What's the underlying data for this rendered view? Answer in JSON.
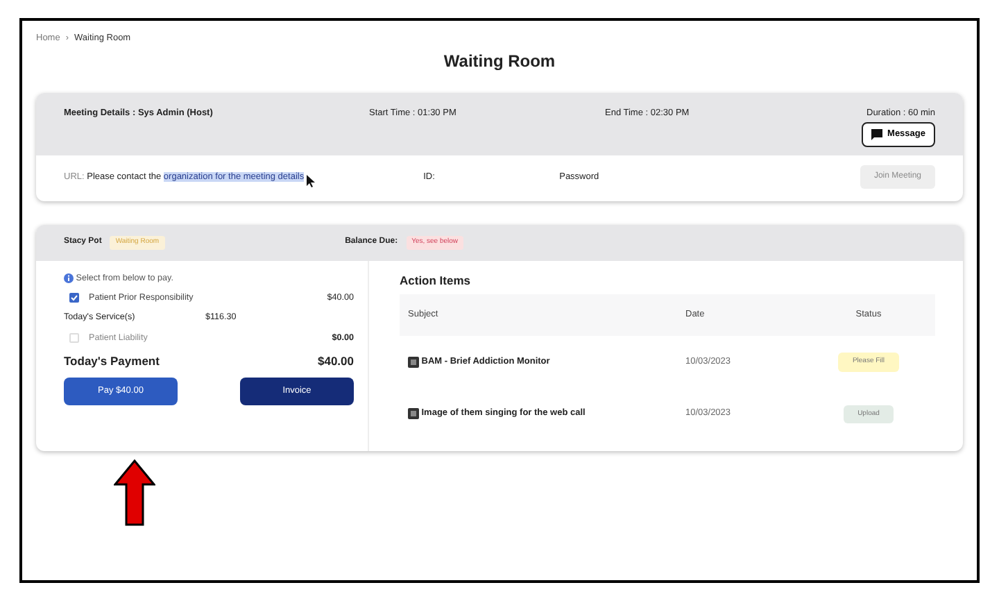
{
  "breadcrumb": [
    {
      "label": "Home"
    },
    {
      "label": "Waiting Room"
    }
  ],
  "breadcrumb_separator": "›",
  "title": "Waiting Room",
  "meeting": {
    "details_label": "Meeting Details :",
    "host": "Sys Admin (Host)",
    "start_time": "Start Time : 01:30 PM",
    "end_time": "End Time : 02:30 PM",
    "duration": "Duration : 60 min",
    "message_button": "Message",
    "url_label": "URL:",
    "url_value_plain": "Please contact the ",
    "url_value_selected": "organization for the meeting details",
    "selection_highlighted": true,
    "id_label": "ID:",
    "password_label": "Password",
    "join_button": {
      "label": "Join Meeting",
      "disabled": true
    }
  },
  "patient": {
    "name": "Stacy Pot",
    "status_badge": "Waiting Room",
    "balance_label": "Balance Due:",
    "balance_badge": "Yes, see below"
  },
  "payment": {
    "hint": "Select from below to pay.",
    "lines": [
      {
        "kind": "checkbox",
        "label": "Patient Prior Responsibility",
        "amount": "$40.00",
        "checked": true,
        "disabled": false
      },
      {
        "kind": "info",
        "label": "Today's Service(s)",
        "amount": "$116.30"
      },
      {
        "kind": "checkbox",
        "label": "Patient Liability",
        "amount": "$0.00",
        "checked": false,
        "disabled": true
      }
    ],
    "total_label": "Today's Payment",
    "total_amount": "$40.00",
    "pay_button": "Pay $40.00",
    "invoice_button": "Invoice"
  },
  "action_items": {
    "title": "Action Items",
    "columns": [
      "Subject",
      "Date",
      "Status"
    ],
    "rows": [
      {
        "subject": "BAM - Brief Addiction Monitor",
        "date": "10/03/2023",
        "status": "Please Fill",
        "color": "#fff7c2"
      },
      {
        "subject": "Image of them singing for the web call",
        "date": "10/03/2023",
        "status": "Upload",
        "color": "#e3ece6"
      }
    ]
  },
  "annotation": {
    "kind": "up-arrow"
  }
}
